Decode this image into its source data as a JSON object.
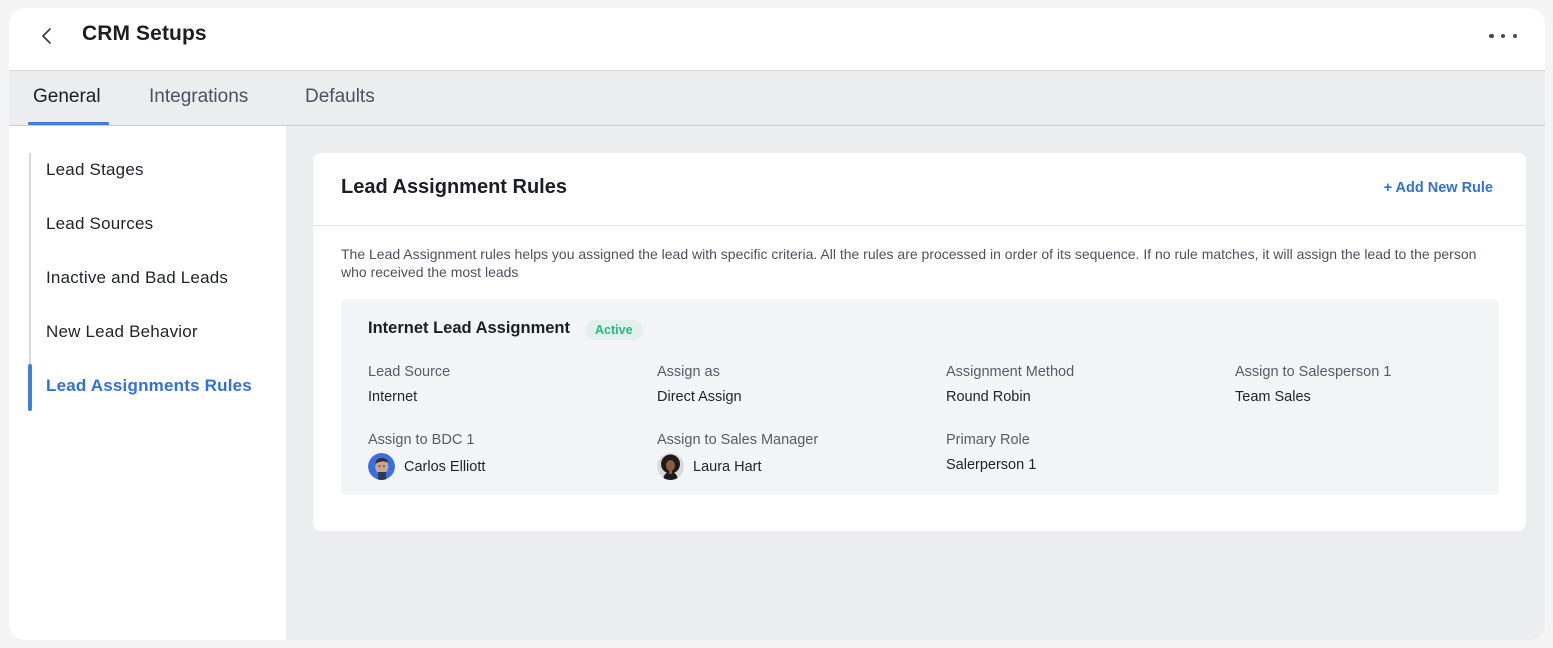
{
  "header": {
    "title": "CRM Setups",
    "back_icon": "chevron-left-icon",
    "more_icon": "more-horizontal-icon"
  },
  "tabs": [
    {
      "label": "General",
      "active": true
    },
    {
      "label": "Integrations",
      "active": false
    },
    {
      "label": "Defaults",
      "active": false
    }
  ],
  "sidebar": {
    "items": [
      {
        "label": "Lead Stages",
        "active": false
      },
      {
        "label": "Lead Sources",
        "active": false
      },
      {
        "label": "Inactive and Bad Leads",
        "active": false
      },
      {
        "label": "New Lead Behavior",
        "active": false
      },
      {
        "label": "Lead Assignments Rules",
        "active": true
      }
    ]
  },
  "card": {
    "title": "Lead Assignment Rules",
    "add_button": "+ Add New Rule",
    "description": "The Lead Assignment rules helps you assigned the lead with specific criteria. All the rules are processed in order of its sequence. If no rule matches, it will assign the lead to the person who received the most leads",
    "rule": {
      "name": "Internet Lead Assignment",
      "status": "Active",
      "fields": [
        {
          "label": "Lead Source",
          "value": "Internet"
        },
        {
          "label": "Assign as",
          "value": "Direct Assign"
        },
        {
          "label": "Assignment Method",
          "value": "Round Robin"
        },
        {
          "label": "Assign to Salesperson 1",
          "value": "Team Sales"
        },
        {
          "label": "Assign to BDC 1",
          "value": "Carlos Elliott",
          "avatar": "avatar-carlos-elliott"
        },
        {
          "label": "Assign to Sales Manager",
          "value": "Laura Hart",
          "avatar": "avatar-laura-hart"
        },
        {
          "label": "Primary Role",
          "value": "Salerperson 1"
        }
      ]
    }
  },
  "colors": {
    "accent": "#3e7de8",
    "link": "#2f6fe0",
    "active_badge_text": "#2eb583",
    "active_badge_bg": "#e1f0ec"
  }
}
